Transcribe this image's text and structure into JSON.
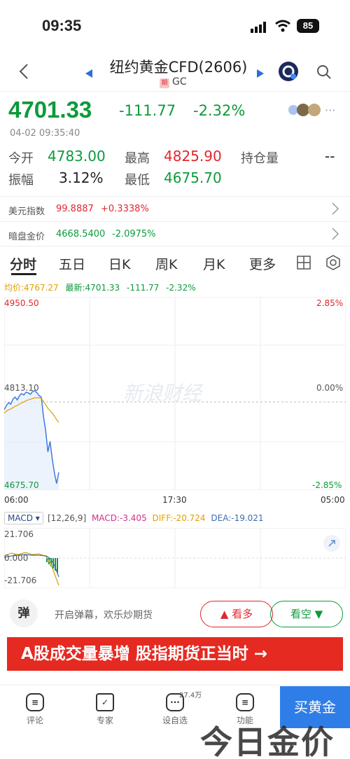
{
  "status": {
    "time": "09:35",
    "battery": "85"
  },
  "header": {
    "title": "纽约黄金CFD(2606)",
    "tag": "期",
    "symbol": "GC"
  },
  "quote": {
    "price": "4701.33",
    "change": "-111.77",
    "change_pct": "-2.32%",
    "datetime": "04-02 09:35:40",
    "open_label": "今开",
    "open": "4783.00",
    "high_label": "最高",
    "high": "4825.90",
    "oi_label": "持仓量",
    "oi": "--",
    "amp_label": "振幅",
    "amp": "3.12%",
    "low_label": "最低",
    "low": "4675.70"
  },
  "related": [
    {
      "label": "美元指数",
      "value": "99.8887",
      "change": "+0.3338%"
    },
    {
      "label": "暗盘金价",
      "value": "4668.5400",
      "change": "-2.0975%"
    }
  ],
  "tabs": [
    "分时",
    "五日",
    "日K",
    "周K",
    "月K",
    "更多"
  ],
  "chart_info": {
    "avg": "均价:4767.27",
    "latest": "最新:4701.33",
    "chg": "-111.77",
    "pct": "-2.32%"
  },
  "chart_data": {
    "type": "line",
    "ylim": [
      4675.7,
      4950.5
    ],
    "y_top": "4950.50",
    "y_mid": "4813.10",
    "y_bottom": "4675.70",
    "pct_top": "2.85%",
    "pct_mid": "0.00%",
    "pct_bottom": "-2.85%",
    "x_labels": [
      "06:00",
      "17:30",
      "05:00"
    ],
    "series": [
      {
        "values": [
          4790,
          4796,
          4800,
          4798,
          4805,
          4808,
          4804,
          4810,
          4813,
          4811,
          4815,
          4814,
          4812,
          4816,
          4817,
          4814,
          4810,
          4808,
          4780,
          4760,
          4730,
          4745,
          4720,
          4700,
          4685,
          4701
        ]
      },
      {
        "values": [
          4785,
          4788,
          4790,
          4791,
          4793,
          4795,
          4796,
          4798,
          4800,
          4801,
          4803,
          4804,
          4805,
          4806,
          4807,
          4807,
          4807,
          4806,
          4802,
          4797,
          4792,
          4789,
          4785,
          4781,
          4776,
          4772
        ]
      }
    ]
  },
  "macd": {
    "name": "MACD",
    "params": "[12,26,9]",
    "macd": "MACD:-3.405",
    "diff": "DIFF:-20.724",
    "dea": "DEA:-19.021",
    "top": "21.706",
    "zero": "0.000",
    "bottom": "-21.706"
  },
  "watermark": "新浪财经",
  "bottom": {
    "danmu": "弹",
    "danmu_text": "开启弹幕，欢乐炒期货",
    "bull": "看多",
    "bear": "看空",
    "banner": "A股成交量暴增 股指期货正当时 →",
    "nav": [
      "评论",
      "专家",
      "设自选",
      "功能"
    ],
    "badge": "27.4万",
    "buy": "买黄金",
    "logo": "今日金价"
  }
}
